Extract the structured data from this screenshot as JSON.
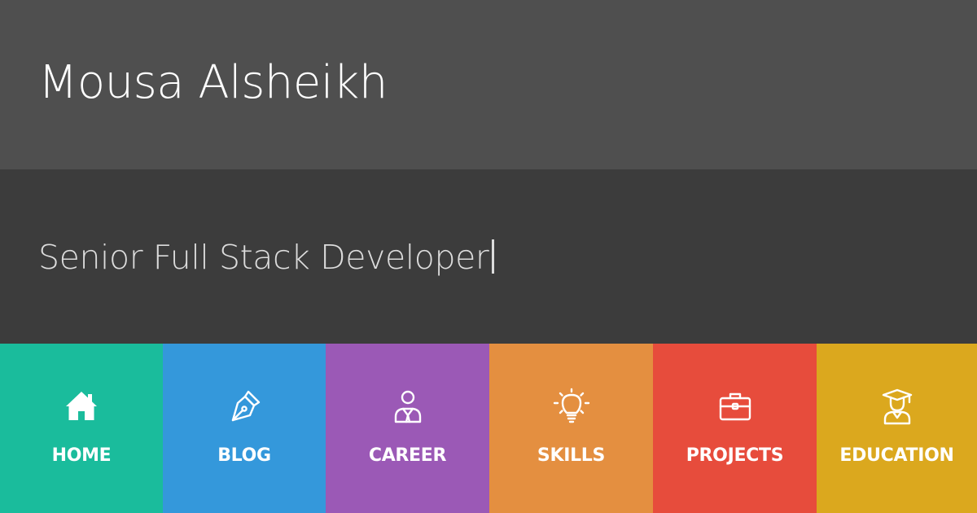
{
  "header": {
    "name": "Mousa Alsheikh",
    "background": "#4f4f4f"
  },
  "subheader": {
    "tagline": "Senior Full Stack Developer",
    "cursor": "|",
    "background": "#3c3c3c"
  },
  "nav": {
    "items": [
      {
        "label": "HOME",
        "icon": "home-icon",
        "color": "#1abc9c"
      },
      {
        "label": "BLOG",
        "icon": "pen-nib-icon",
        "color": "#3498db"
      },
      {
        "label": "CAREER",
        "icon": "businessman-icon",
        "color": "#9b59b6"
      },
      {
        "label": "SKILLS",
        "icon": "lightbulb-icon",
        "color": "#e48f40"
      },
      {
        "label": "PROJECTS",
        "icon": "briefcase-icon",
        "color": "#e74c3c"
      },
      {
        "label": "EDUCATION",
        "icon": "graduate-icon",
        "color": "#dba81e"
      }
    ]
  }
}
